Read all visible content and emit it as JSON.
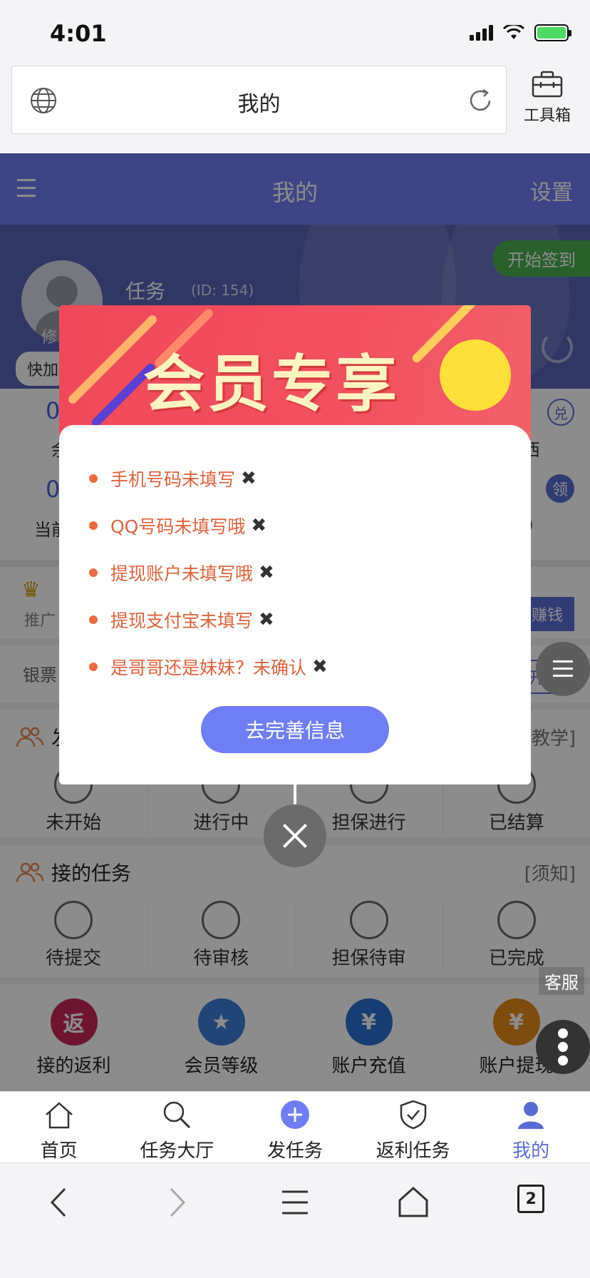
{
  "status": {
    "time": "4:01"
  },
  "browser": {
    "page_title": "我的",
    "toolbox_label": "工具箱",
    "tab_count": "2"
  },
  "header": {
    "title": "我的",
    "settings": "设置"
  },
  "profile": {
    "checkin": "开始签到",
    "edit": "修",
    "username": "任务",
    "user_id": "(ID: 154)",
    "quick_add": "快加"
  },
  "stats": {
    "row1_value": "0",
    "row2_value": "0",
    "row1_label_left": "余",
    "row1_label_right": "西",
    "row2_label_left": "当前",
    "row2_label_right": "0",
    "badge_exchange": "兑",
    "badge_receive": "领"
  },
  "promo": {
    "sub": "推广",
    "earn_button": "赚钱"
  },
  "banknote": {
    "label": "银票",
    "button": "开抢"
  },
  "published_tasks": {
    "title": "发",
    "right_link": "[教学]",
    "items": [
      "未开始",
      "进行中",
      "担保进行",
      "已结算"
    ]
  },
  "received_tasks": {
    "title": "接的任务",
    "right_link": "[须知]",
    "items": [
      "待提交",
      "待审核",
      "担保待审",
      "已完成"
    ]
  },
  "shortcuts": [
    {
      "label": "接的返利",
      "glyph": "返",
      "color": "#c8285a"
    },
    {
      "label": "会员等级",
      "glyph": "★",
      "color": "#3f7fd9"
    },
    {
      "label": "账户充值",
      "glyph": "¥",
      "color": "#2c6fd0"
    },
    {
      "label": "账户提现",
      "glyph": "¥",
      "color": "#e58a1a"
    }
  ],
  "service_label": "客服",
  "tabbar": [
    "首页",
    "任务大厅",
    "发任务",
    "返利任务",
    "我的"
  ],
  "modal": {
    "banner_title": "会员专享",
    "items": [
      "手机号码未填写",
      "QQ号码未填写哦",
      "提现账户未填写哦",
      "提现支付宝未填写",
      "是哥哥还是妹妹？未确认"
    ],
    "mark": "✖",
    "button": "去完善信息"
  }
}
